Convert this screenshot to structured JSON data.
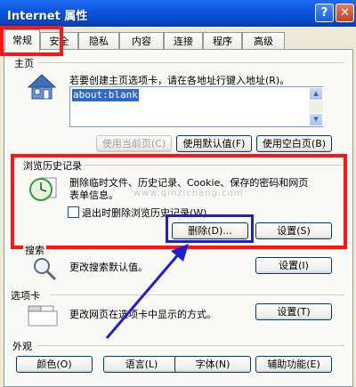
{
  "window": {
    "title": "Internet 属性",
    "help_label": "?",
    "close_label": "✕"
  },
  "tabs": [
    {
      "label": "常规"
    },
    {
      "label": "安全"
    },
    {
      "label": "隐私"
    },
    {
      "label": "内容"
    },
    {
      "label": "连接"
    },
    {
      "label": "程序"
    },
    {
      "label": "高级"
    }
  ],
  "homepage": {
    "group_label": "主页",
    "description": "若要创建主页选项卡，请在各地址行键入地址(R)。",
    "url_value": "about:blank",
    "buttons": {
      "use_current": "使用当前页(C)",
      "use_default": "使用默认值(F)",
      "use_blank": "使用空白页(B)"
    }
  },
  "history": {
    "group_label": "浏览历史记录",
    "description_line1": "删除临时文件、历史记录、Cookie、保存的密码和网页",
    "description_line2": "表单信息。",
    "checkbox_label": "退出时删除浏览历史记录(W)",
    "delete_button": "删除(D)...",
    "settings_button": "设置(S)"
  },
  "search": {
    "group_label": "搜索",
    "description": "更改搜索默认值。",
    "settings_button": "设置(I)"
  },
  "tabs_group": {
    "group_label": "选项卡",
    "description": "更改网页在选项卡中显示的方式。",
    "settings_button": "设置(T)"
  },
  "appearance": {
    "group_label": "外观",
    "buttons": {
      "colors": "颜色(O)",
      "languages": "语言(L)",
      "fonts": "字体(N)",
      "accessibility": "辅助功能(E)"
    }
  },
  "watermark": "www.qinzichang.com",
  "colors": {
    "title_blue": "#0a56e0",
    "annotation_red": "#ff1515",
    "annotation_blue": "#1f1fd0"
  }
}
